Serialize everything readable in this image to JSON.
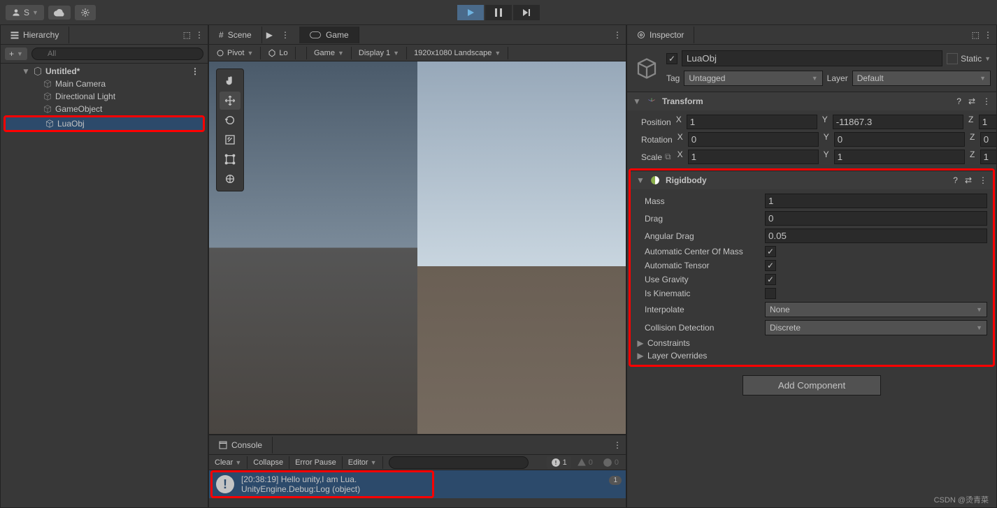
{
  "topbar": {
    "account": "S"
  },
  "play": {
    "playing": true
  },
  "hierarchy": {
    "title": "Hierarchy",
    "search_placeholder": "All",
    "scene": "Untitled*",
    "items": [
      "Main Camera",
      "Directional Light",
      "GameObject",
      "LuaObj"
    ],
    "selected": "LuaObj"
  },
  "scene": {
    "title": "Scene",
    "pivot": "Pivot",
    "local": "Lo"
  },
  "game": {
    "title": "Game",
    "mode": "Game",
    "display": "Display 1",
    "resolution": "1920x1080 Landscape"
  },
  "inspector": {
    "title": "Inspector",
    "object_name": "LuaObj",
    "enabled": true,
    "static_label": "Static",
    "tag_label": "Tag",
    "tag_value": "Untagged",
    "layer_label": "Layer",
    "layer_value": "Default",
    "transform": {
      "title": "Transform",
      "position_label": "Position",
      "rotation_label": "Rotation",
      "scale_label": "Scale",
      "position": {
        "x": "1",
        "y": "-11867.3",
        "z": "1"
      },
      "rotation": {
        "x": "0",
        "y": "0",
        "z": "0"
      },
      "scale": {
        "x": "1",
        "y": "1",
        "z": "1"
      }
    },
    "rigidbody": {
      "title": "Rigidbody",
      "mass_label": "Mass",
      "mass": "1",
      "drag_label": "Drag",
      "drag": "0",
      "angular_drag_label": "Angular Drag",
      "angular_drag": "0.05",
      "acom_label": "Automatic Center Of Mass",
      "acom": true,
      "atensor_label": "Automatic Tensor",
      "atensor": true,
      "gravity_label": "Use Gravity",
      "gravity": true,
      "kinematic_label": "Is Kinematic",
      "kinematic": false,
      "interpolate_label": "Interpolate",
      "interpolate": "None",
      "collision_label": "Collision Detection",
      "collision": "Discrete",
      "constraints_label": "Constraints",
      "overrides_label": "Layer Overrides"
    },
    "add_component": "Add Component"
  },
  "console": {
    "title": "Console",
    "clear": "Clear",
    "collapse": "Collapse",
    "error_pause": "Error Pause",
    "editor": "Editor",
    "info_count": "1",
    "warn_count": "0",
    "error_count": "0",
    "log_line1": "[20:38:19] Hello unity,I am Lua.",
    "log_line2": "UnityEngine.Debug:Log (object)",
    "log_badge": "1"
  },
  "watermark": "CSDN @烫青菜"
}
